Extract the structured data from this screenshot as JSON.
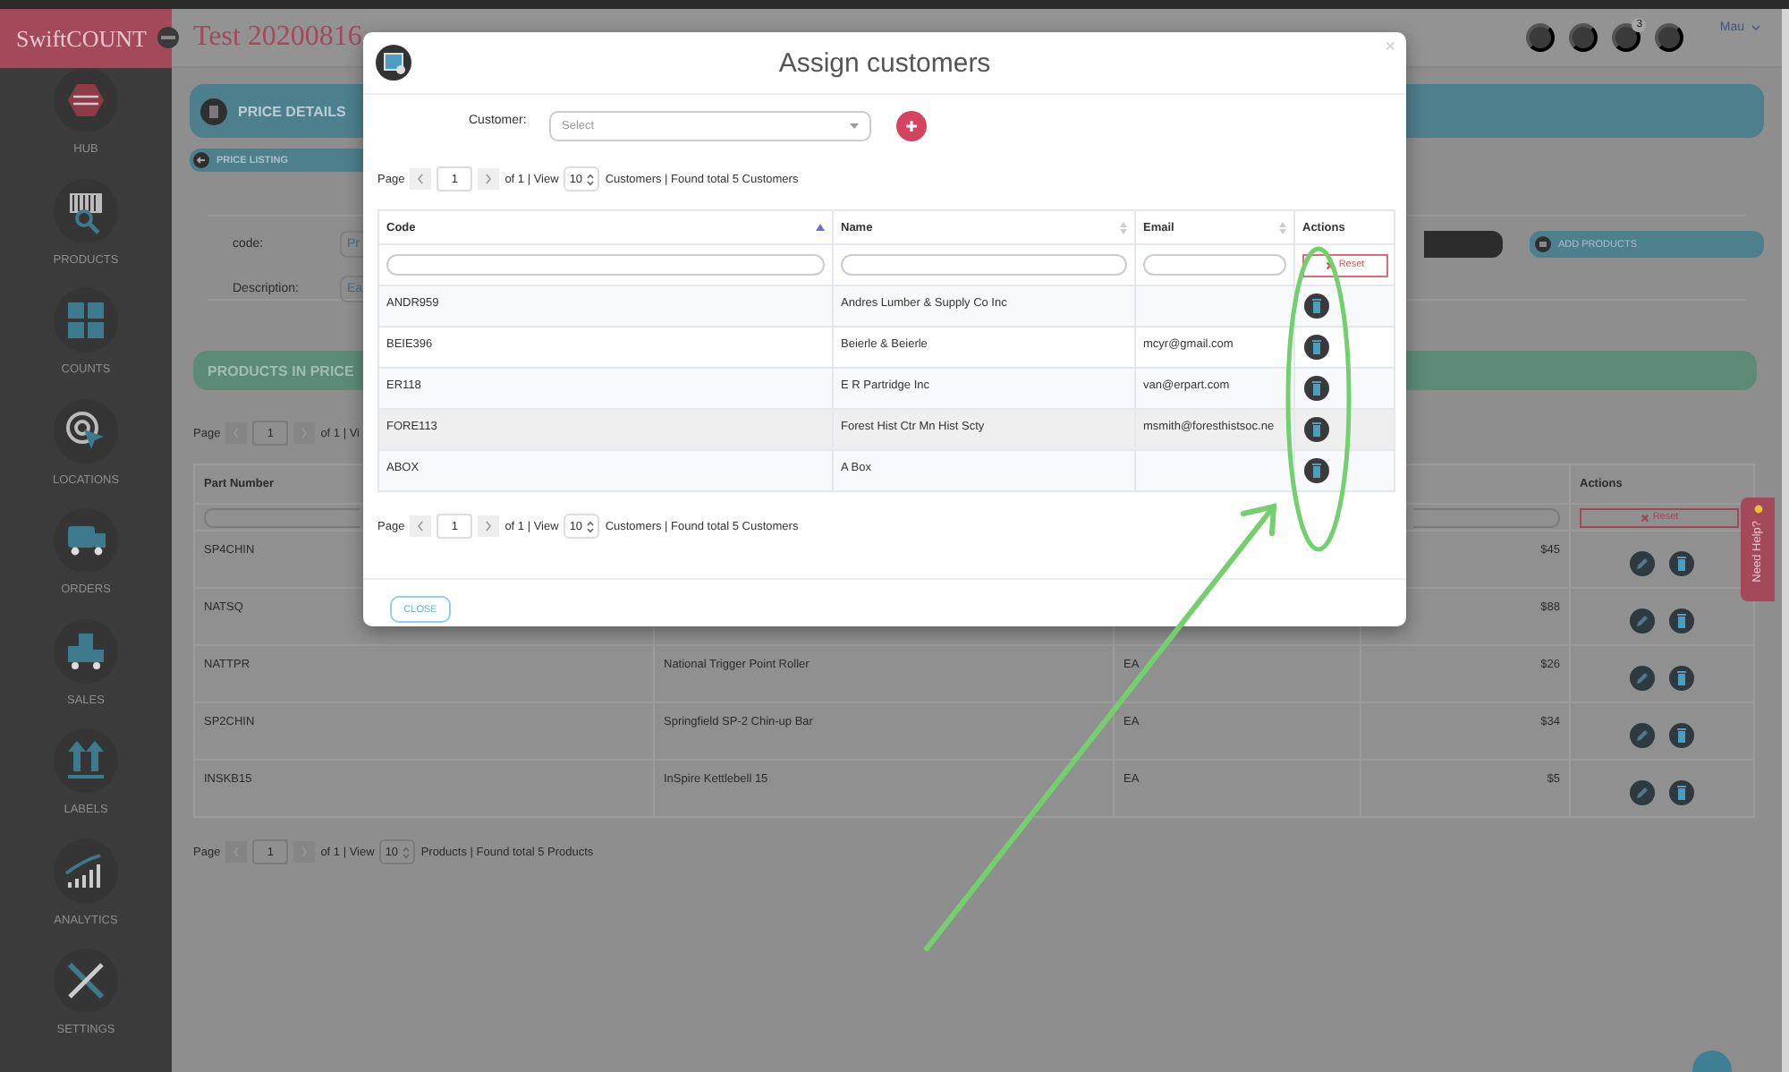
{
  "sidebar": {
    "logo": "SwiftCOUNT",
    "items": [
      {
        "label": "HUB",
        "kind": "hub"
      },
      {
        "label": "PRODUCTS",
        "kind": "products"
      },
      {
        "label": "COUNTS",
        "kind": "counts"
      },
      {
        "label": "LOCATIONS",
        "kind": "locations"
      },
      {
        "label": "ORDERS",
        "kind": "orders"
      },
      {
        "label": "SALES",
        "kind": "sales"
      },
      {
        "label": "LABELS",
        "kind": "labels"
      },
      {
        "label": "ANALYTICS",
        "kind": "analytics"
      },
      {
        "label": "SETTINGS",
        "kind": "settings"
      }
    ]
  },
  "header": {
    "title": "Test 20200816",
    "notification_count": "3",
    "user": "Mau"
  },
  "price_details": {
    "title": "PRICE DETAILS",
    "back_link": "PRICE LISTING",
    "fields": [
      {
        "label": "code:",
        "value": "Pr"
      },
      {
        "label": "Description:",
        "value": "Ea"
      }
    ],
    "add_button": "ADD PRODUCTS"
  },
  "products_panel": {
    "title": "PRODUCTS IN PRICE",
    "top_pager": {
      "page_label": "Page",
      "page": "1",
      "of": "of 1 | Vi"
    },
    "table": {
      "columns": [
        "Part Number",
        "Actions"
      ],
      "reset": "Reset",
      "rows": [
        {
          "part_number": "SP4CHIN",
          "price": "$45"
        },
        {
          "part_number": "NATSQ",
          "price": "$88"
        },
        {
          "part_number": "NATTPR",
          "description": "National Trigger Point Roller",
          "unit": "EA",
          "price": "$26"
        },
        {
          "part_number": "SP2CHIN",
          "description": "Springfield SP-2 Chin-up Bar",
          "unit": "EA",
          "price": "$34"
        },
        {
          "part_number": "INSKB15",
          "description": "InSpire Kettlebell 15",
          "unit": "EA",
          "price": "$5"
        }
      ]
    },
    "bottom_pager": {
      "page_label": "Page",
      "page": "1",
      "of": "of 1 | View",
      "per_page": "10",
      "summary": "Products | Found total 5 Products"
    }
  },
  "need_help": "Need Help?",
  "modal": {
    "title": "Assign customers",
    "close": "×",
    "customer_label": "Customer:",
    "customer_placeholder": "Select",
    "top_pager": {
      "page_label": "Page",
      "page": "1",
      "of": "of 1 | View",
      "per_page": "10",
      "summary": "Customers | Found total 5 Customers"
    },
    "table": {
      "columns": [
        {
          "label": "Code",
          "sortable": true,
          "sorted": true
        },
        {
          "label": "Name",
          "sortable": true,
          "sorted": false
        },
        {
          "label": "Email",
          "sortable": true,
          "sorted": false
        },
        {
          "label": "Actions",
          "sortable": false
        }
      ],
      "reset": "Reset",
      "rows": [
        {
          "code": "ANDR959",
          "name": "Andres Lumber & Supply Co Inc",
          "hovered": false
        },
        {
          "code": "BEIE396",
          "name": "Beierle & Beierle",
          "email": "mcyr@gmail.com",
          "hovered": false
        },
        {
          "code": "ER118",
          "name": "E R Partridge Inc",
          "email": "van@erpart.com",
          "hovered": false
        },
        {
          "code": "FORE113",
          "name": "Forest Hist Ctr Mn Hist Scty",
          "email": "msmith@foresthistsoc.ne",
          "hovered": true
        },
        {
          "code": "ABOX",
          "name": "A Box",
          "hovered": false
        }
      ]
    },
    "bottom_pager": {
      "page_label": "Page",
      "page": "1",
      "of": "of 1 | View",
      "per_page": "10",
      "summary": "Customers | Found total 5 Customers"
    },
    "close_button": "CLOSE"
  }
}
